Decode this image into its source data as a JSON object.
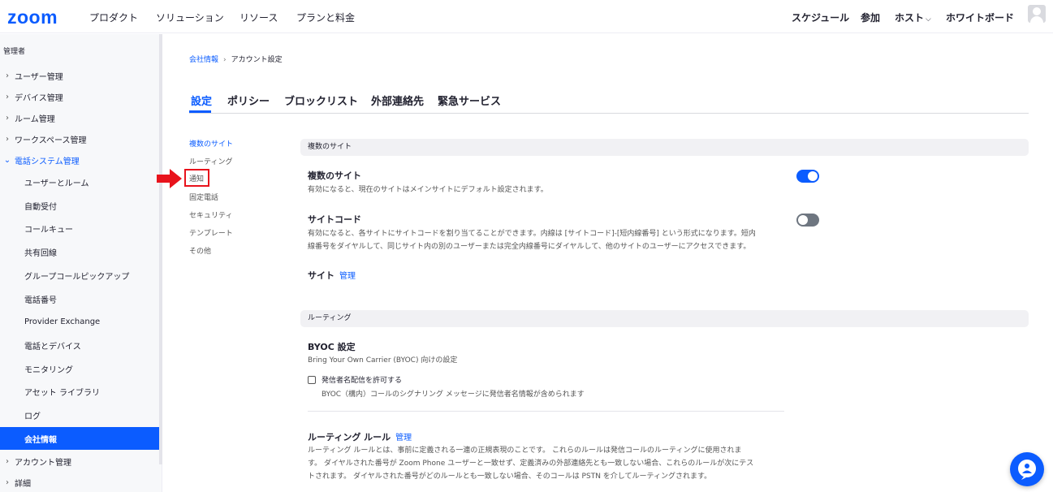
{
  "topnav": {
    "logo": "zoom",
    "left_items": [
      "プロダクト",
      "ソリューション",
      "リソース",
      "プランと料金"
    ],
    "right_items": {
      "schedule": "スケジュール",
      "join": "参加",
      "host": "ホスト",
      "whiteboard": "ホワイトボード"
    }
  },
  "sidebar": {
    "header": "管理者",
    "top_items": [
      "ユーザー管理",
      "デバイス管理",
      "ルーム管理",
      "ワークスペース管理"
    ],
    "phone_system": "電話システム管理",
    "sub_items": [
      "ユーザーとルーム",
      "自動受付",
      "コールキュー",
      "共有回線",
      "グループコールピックアップ",
      "電話番号",
      "Provider Exchange",
      "電話とデバイス",
      "モニタリング",
      "アセット ライブラリ",
      "ログ",
      "会社情報"
    ],
    "bottom_items": [
      "アカウント管理",
      "詳細"
    ]
  },
  "breadcrumb": {
    "link": "会社情報",
    "separator": "›",
    "current": "アカウント設定"
  },
  "tabs": [
    "設定",
    "ポリシー",
    "ブロックリスト",
    "外部連絡先",
    "緊急サービス"
  ],
  "subnav": [
    "複数のサイト",
    "ルーティング",
    "通知",
    "固定電話",
    "セキュリティ",
    "テンプレート",
    "その他"
  ],
  "sections": {
    "multi_site_header": "複数のサイト",
    "multi_site": {
      "title": "複数のサイト",
      "desc": "有効になると、現在のサイトはメインサイトにデフォルト設定されます。",
      "enabled": true
    },
    "site_code": {
      "title": "サイトコード",
      "desc1": "有効になると、各サイトにサイトコードを割り当てることができます。内線は [サイトコード]-[短内線番号] という形式になります。短内",
      "desc2": "線番号をダイヤルして、同じサイト内の別のユーザーまたは完全内線番号にダイヤルして、他のサイトのユーザーにアクセスできます。",
      "enabled": false
    },
    "sites": {
      "title": "サイト",
      "manage": "管理"
    },
    "routing_header": "ルーティング",
    "byoc": {
      "title": "BYOC 設定",
      "desc": "Bring Your Own Carrier (BYOC) 向けの設定",
      "checkbox_label": "発信者名配信を許可する",
      "checkbox_help": "BYOC（構内）コールのシグナリング メッセージに発信者名情報が含められます",
      "checked": false
    },
    "routing_rules": {
      "title": "ルーティング ルール",
      "manage": "管理",
      "desc1": "ルーティング ルールとは、事前に定義される一連の正規表現のことです。 これらのルールは発信コールのルーティングに使用されま",
      "desc2": "す。 ダイヤルされた番号が Zoom Phone ユーザーと一致せず、定義済みの外部連絡先とも一致しない場合、これらのルールが次にテス",
      "desc3": "トされます。 ダイヤルされた番号がどのルールとも一致しない場合、そのコールは PSTN を介してルーティングされます。"
    }
  },
  "colors": {
    "accent": "#0b5cff",
    "highlight": "#e8131c"
  }
}
